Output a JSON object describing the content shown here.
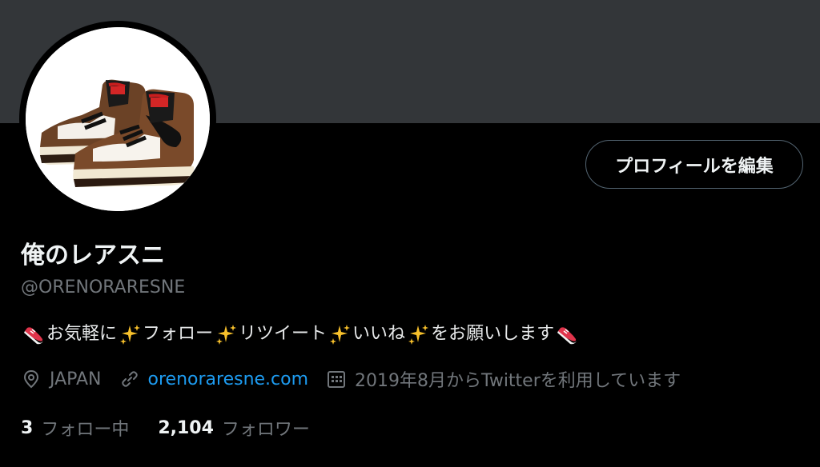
{
  "profile": {
    "display_name": "俺のレアスニ",
    "handle": "@ORENORARESNE",
    "edit_button": "プロフィールを編集",
    "bio": {
      "segments": [
        {
          "type": "emoji",
          "icon": "sneaker-emoji"
        },
        {
          "type": "text",
          "text": "お気軽に"
        },
        {
          "type": "emoji",
          "icon": "sparkles-emoji"
        },
        {
          "type": "text",
          "text": "フォロー"
        },
        {
          "type": "emoji",
          "icon": "sparkles-emoji"
        },
        {
          "type": "text",
          "text": "リツイート"
        },
        {
          "type": "emoji",
          "icon": "sparkles-emoji"
        },
        {
          "type": "text",
          "text": "いいね"
        },
        {
          "type": "emoji",
          "icon": "sparkles-emoji"
        },
        {
          "type": "text",
          "text": "をお願いします"
        },
        {
          "type": "emoji",
          "icon": "sneaker-emoji"
        }
      ]
    },
    "location": "JAPAN",
    "website": "orenoraresne.com",
    "joined": "2019年8月からTwitterを利用しています",
    "following_count": "3",
    "following_label": "フォロー中",
    "followers_count": "2,104",
    "followers_label": "フォロワー"
  },
  "colors": {
    "background": "#000000",
    "banner": "#333639",
    "secondary_text": "#71767b",
    "link": "#1d9bf0",
    "primary_text": "#eff3f4"
  },
  "icons": {
    "location": "location-pin-icon",
    "website": "link-icon",
    "joined": "calendar-icon"
  }
}
